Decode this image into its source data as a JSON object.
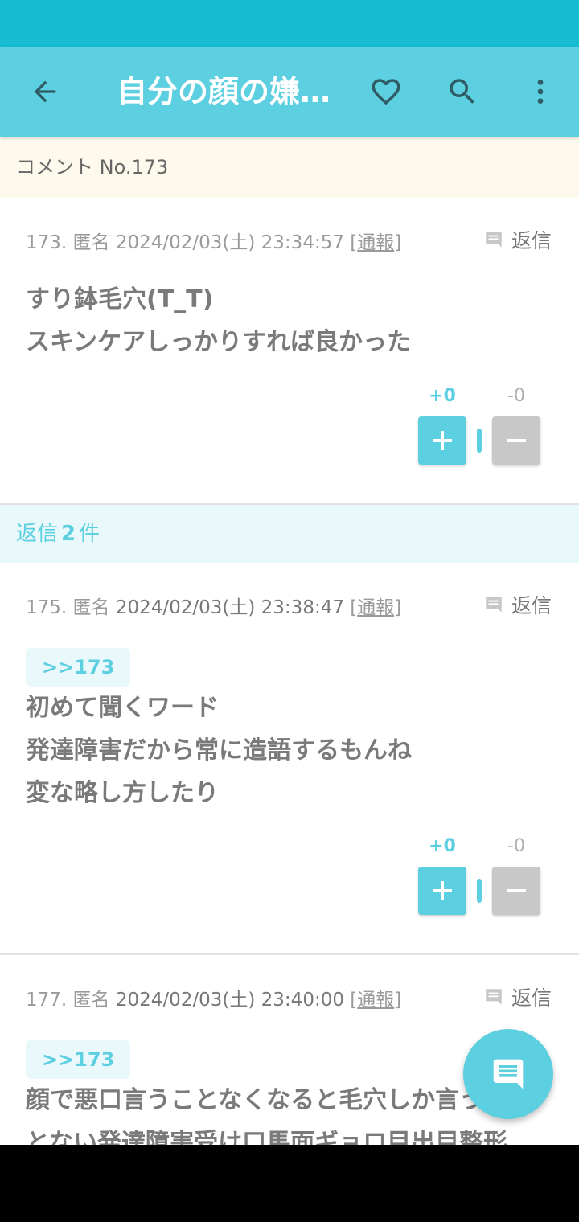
{
  "app": {
    "title": "自分の顔の嫌…",
    "back_icon": "arrow-left-icon",
    "favorite_icon": "heart-outline-icon",
    "search_icon": "search-icon",
    "more_icon": "more-vertical-icon",
    "accent_color": "#5ccfe0",
    "statusbar_color": "#17bcd3"
  },
  "subheader": {
    "label": "コメント No.173"
  },
  "comments": [
    {
      "number": "173.",
      "name": "匿名",
      "date": "2024/02/03(土) 23:34:57",
      "report_open": "[",
      "report_label": "通報",
      "report_close": "]",
      "reply_label": "返信",
      "anchor": "",
      "lines": [
        "すり鉢毛穴(T_T)",
        "スキンケアしっかりすれば良かった"
      ],
      "plus_label": "+0",
      "minus_label": "-0"
    },
    {
      "number": "175.",
      "name": "匿名",
      "date": "2024/02/03(土) 23:38:47",
      "report_open": "[",
      "report_label": "通報",
      "report_close": "]",
      "reply_label": "返信",
      "anchor": ">>173",
      "lines": [
        "初めて聞くワード",
        "発達障害だから常に造語するもんね",
        "変な略し方したり"
      ],
      "plus_label": "+0",
      "minus_label": "-0"
    },
    {
      "number": "177.",
      "name": "匿名",
      "date": "2024/02/03(土) 23:40:00",
      "report_open": "[",
      "report_label": "通報",
      "report_close": "]",
      "reply_label": "返信",
      "anchor": ">>173",
      "lines": [
        "顔で悪口言うことなくなると毛穴しか言うこ",
        "とない発達障害受け口馬面ギョロ目出目整形"
      ]
    }
  ],
  "replies_header": {
    "prefix": "返信",
    "count": "2",
    "suffix": "件"
  },
  "fab": {
    "icon": "comment-icon"
  }
}
